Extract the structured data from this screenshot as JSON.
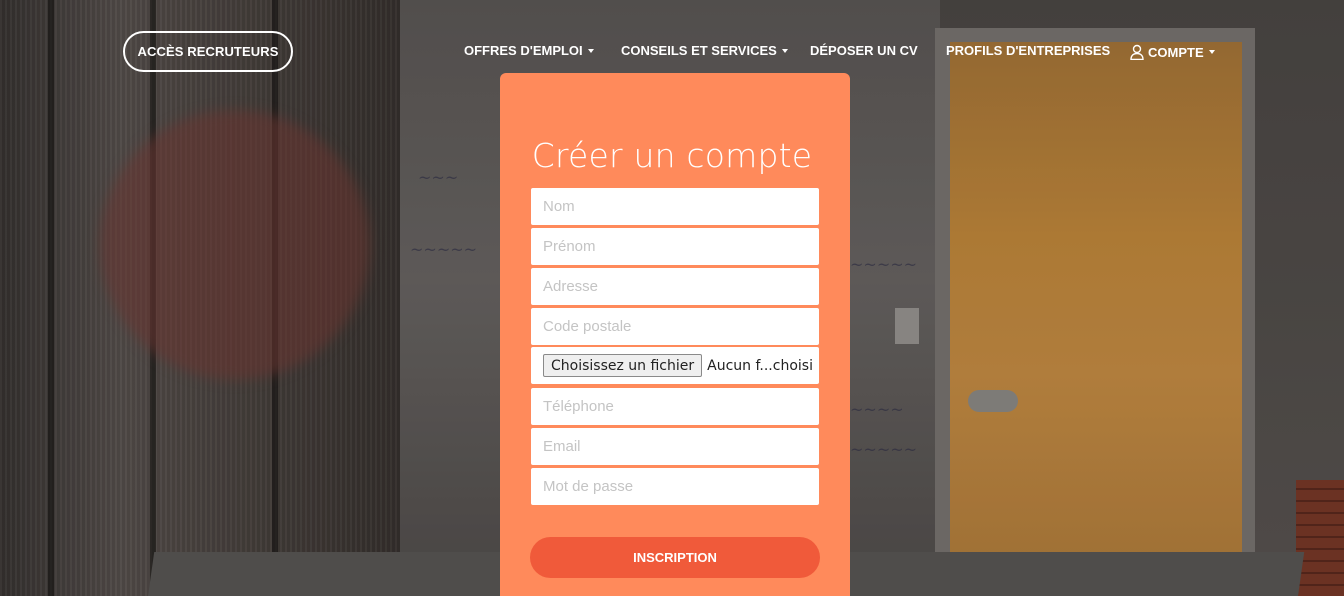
{
  "nav": {
    "recruiter_button": "ACCÈS RECRUTEURS",
    "items": [
      {
        "label": "OFFRES D'EMPLOI",
        "has_dropdown": true
      },
      {
        "label": "CONSEILS ET SERVICES",
        "has_dropdown": true
      },
      {
        "label": "DÉPOSER UN CV",
        "has_dropdown": false
      },
      {
        "label": "PROFILS D'ENTREPRISES",
        "has_dropdown": false
      },
      {
        "label": "COMPTE",
        "has_dropdown": true,
        "icon": "user-icon"
      }
    ]
  },
  "form": {
    "title": "Créer un compte",
    "fields": {
      "nom": {
        "placeholder": "Nom",
        "value": ""
      },
      "prenom": {
        "placeholder": "Prénom",
        "value": ""
      },
      "adresse": {
        "placeholder": "Adresse",
        "value": ""
      },
      "code_postal": {
        "placeholder": "Code postale",
        "value": ""
      },
      "telephone": {
        "placeholder": "Téléphone",
        "value": ""
      },
      "email": {
        "placeholder": "Email",
        "value": ""
      },
      "mot_de_passe": {
        "placeholder": "Mot de passe",
        "value": ""
      }
    },
    "file": {
      "button_label": "Choisissez un fichier",
      "status": "Aucun f...choisi"
    },
    "submit_label": "INSCRIPTION"
  },
  "colors": {
    "card": "#ff8a5b",
    "submit": "#f05a3a",
    "text": "#ffffff"
  }
}
